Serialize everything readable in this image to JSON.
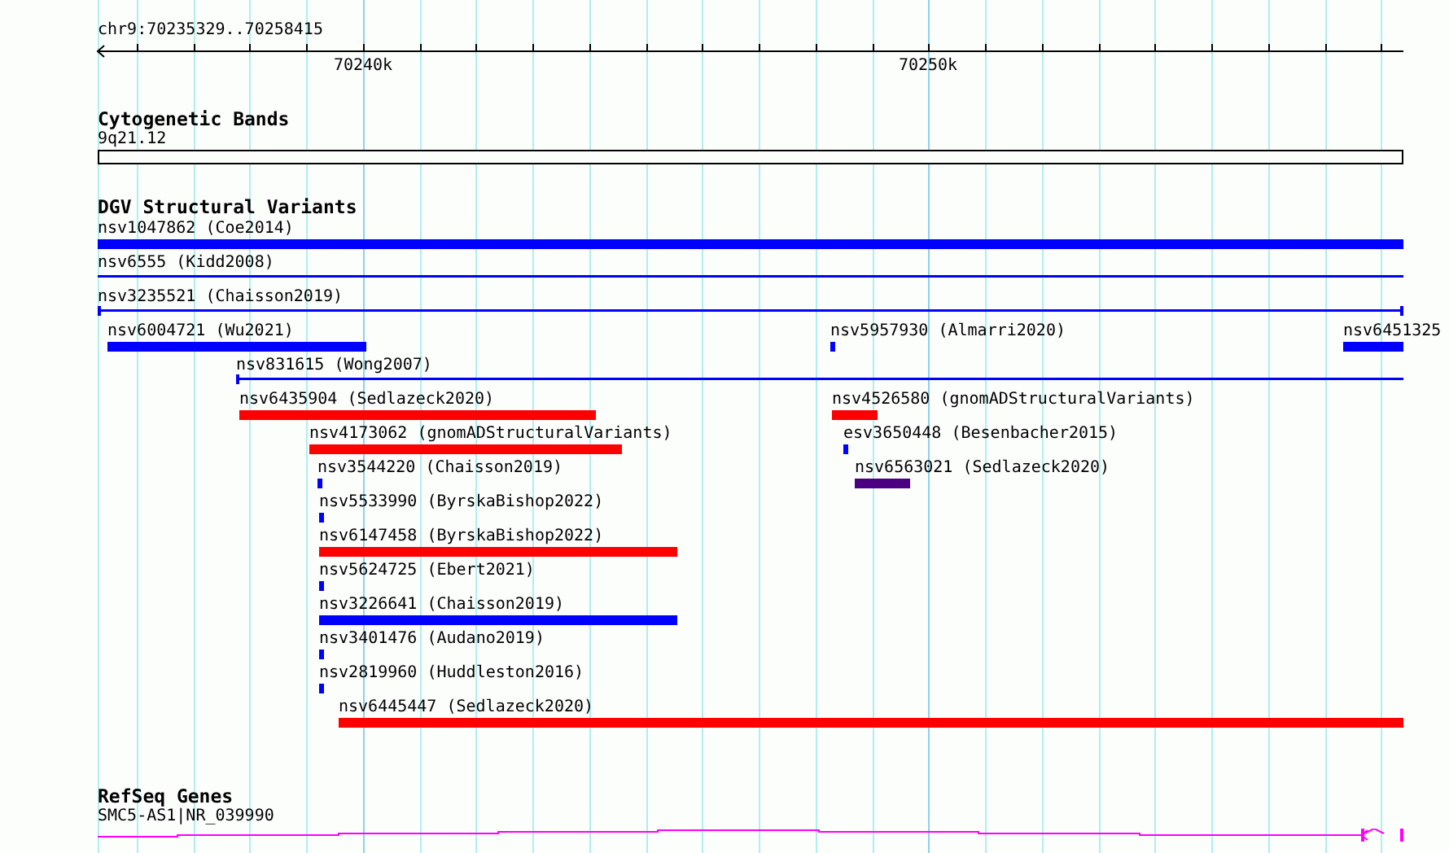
{
  "ruler": {
    "location": "chr9:70235329..70258415",
    "ticks": [
      "70240k",
      "70250k"
    ]
  },
  "cytogenetic_bands": {
    "title": "Cytogenetic Bands",
    "band": "9q21.12"
  },
  "dgv": {
    "title": "DGV Structural Variants",
    "features": [
      {
        "label": "nsv1047862 (Coe2014)",
        "kind": "bar",
        "color": "#0000ff"
      },
      {
        "label": "nsv6555 (Kidd2008)",
        "kind": "line",
        "color": "#0000ff"
      },
      {
        "label": "nsv3235521 (Chaisson2019)",
        "kind": "line",
        "color": "#0000ff"
      },
      {
        "label": "nsv6004721 (Wu2021)",
        "kind": "bar",
        "color": "#0000ff"
      },
      {
        "label": "nsv5957930 (Almarri2020)",
        "kind": "bar",
        "color": "#0000ff"
      },
      {
        "label": "nsv6451325",
        "kind": "bar",
        "color": "#0000ff"
      },
      {
        "label": "nsv831615 (Wong2007)",
        "kind": "line",
        "color": "#0000ff"
      },
      {
        "label": "nsv6435904 (Sedlazeck2020)",
        "kind": "bar",
        "color": "#ff0000"
      },
      {
        "label": "nsv4526580 (gnomADStructuralVariants)",
        "kind": "bar",
        "color": "#ff0000"
      },
      {
        "label": "nsv4173062 (gnomADStructuralVariants)",
        "kind": "bar",
        "color": "#ff0000"
      },
      {
        "label": "esv3650448 (Besenbacher2015)",
        "kind": "bar",
        "color": "#0000ff"
      },
      {
        "label": "nsv3544220 (Chaisson2019)",
        "kind": "bar",
        "color": "#0000ff"
      },
      {
        "label": "nsv6563021 (Sedlazeck2020)",
        "kind": "bar",
        "color": "#4b0082"
      },
      {
        "label": "nsv5533990 (ByrskaBishop2022)",
        "kind": "bar",
        "color": "#0000ff"
      },
      {
        "label": "nsv6147458 (ByrskaBishop2022)",
        "kind": "bar",
        "color": "#ff0000"
      },
      {
        "label": "nsv5624725 (Ebert2021)",
        "kind": "bar",
        "color": "#0000ff"
      },
      {
        "label": "nsv3226641 (Chaisson2019)",
        "kind": "bar",
        "color": "#0000ff"
      },
      {
        "label": "nsv3401476 (Audano2019)",
        "kind": "bar",
        "color": "#0000ff"
      },
      {
        "label": "nsv2819960 (Huddleston2016)",
        "kind": "bar",
        "color": "#0000ff"
      },
      {
        "label": "nsv6445447 (Sedlazeck2020)",
        "kind": "bar",
        "color": "#ff0000"
      }
    ]
  },
  "refseq_genes": {
    "title": "RefSeq Genes",
    "genes": [
      {
        "label": "SMC5-AS1|NR_039990"
      }
    ]
  }
}
